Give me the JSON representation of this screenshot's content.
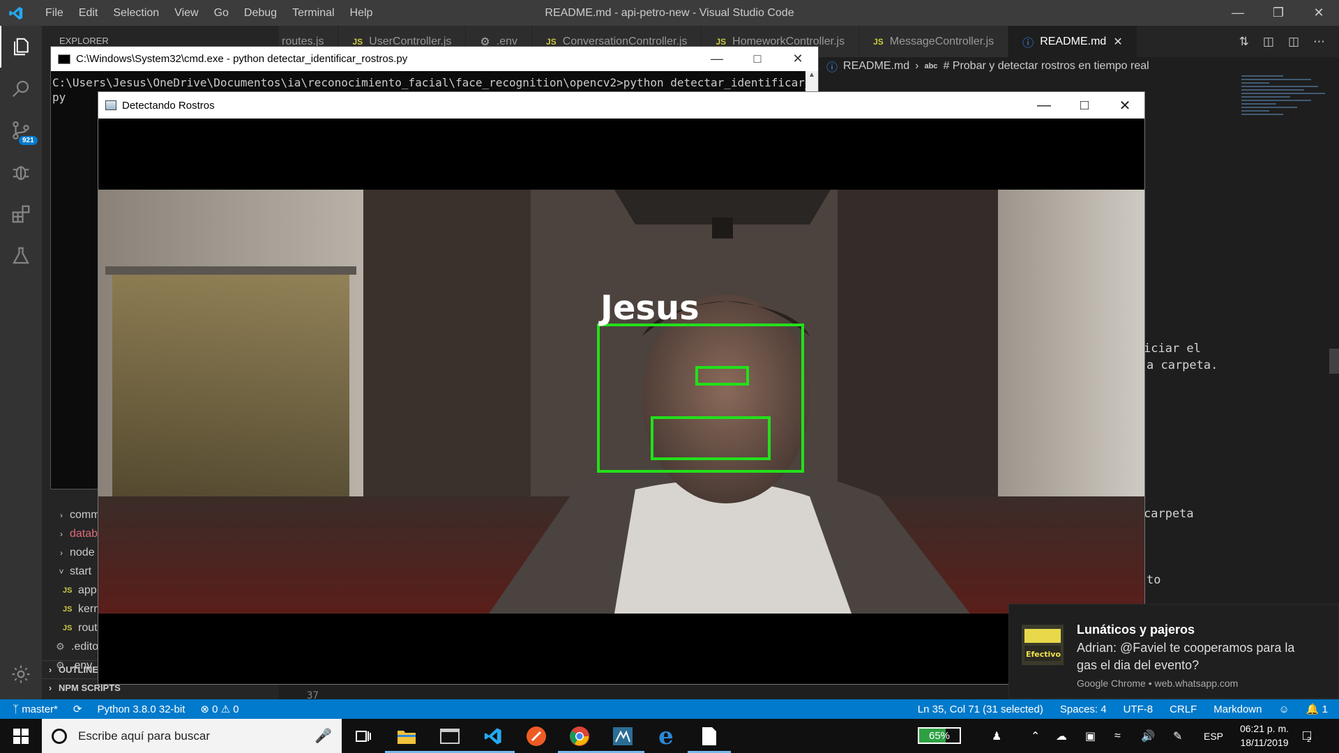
{
  "vscode": {
    "menu": [
      "File",
      "Edit",
      "Selection",
      "View",
      "Go",
      "Debug",
      "Terminal",
      "Help"
    ],
    "window_title": "README.md - api-petro-new - Visual Studio Code",
    "activity_badge": "921",
    "explorer_title": "EXPLORER",
    "tabs": [
      {
        "label": "routes.js",
        "icon": ""
      },
      {
        "label": "UserController.js",
        "icon": "JS"
      },
      {
        "label": ".env",
        "icon": "gear"
      },
      {
        "label": "ConversationController.js",
        "icon": "JS"
      },
      {
        "label": "HomeworkController.js",
        "icon": "JS"
      },
      {
        "label": "MessageController.js",
        "icon": "JS"
      },
      {
        "label": "README.md",
        "icon": "info",
        "active": true
      }
    ],
    "breadcrumb": {
      "file": "README.md",
      "abc_label": "abc",
      "symbol": "# Probar y detectar rostros en tiempo real"
    },
    "editor_lines": [
      {
        "text": "iciar el"
      },
      {
        "text": "a carpeta."
      },
      {
        "text": "carpeta"
      },
      {
        "text": "to"
      }
    ],
    "line_number": "37",
    "tree": [
      {
        "label": "comm",
        "type": "folder",
        "collapsed": true
      },
      {
        "label": "datab",
        "type": "folder",
        "collapsed": true,
        "color": "#e06c75"
      },
      {
        "label": "node",
        "type": "folder",
        "collapsed": true
      },
      {
        "label": "start",
        "type": "folder",
        "collapsed": false
      },
      {
        "label": "app",
        "type": "js"
      },
      {
        "label": "kern",
        "type": "js"
      },
      {
        "label": "rout",
        "type": "js"
      },
      {
        "label": ".edito",
        "type": "gear"
      },
      {
        "label": ".env",
        "type": "gear"
      },
      {
        "label": ".env",
        "type": "plain"
      }
    ],
    "sections": [
      "OUTLINE",
      "NPM SCRIPTS"
    ]
  },
  "statusbar": {
    "branch": "master*",
    "python": "Python 3.8.0 32-bit",
    "errors": "0",
    "warnings": "0",
    "position": "Ln 35, Col 71 (31 selected)",
    "spaces": "Spaces: 4",
    "encoding": "UTF-8",
    "eol": "CRLF",
    "language": "Markdown",
    "bell_count": "1"
  },
  "cmd": {
    "title": "C:\\Windows\\System32\\cmd.exe - python  detectar_identificar_rostros.py",
    "line1": "C:\\Users\\Jesus\\OneDrive\\Documentos\\ia\\reconocimiento_facial\\face_recognition\\opencv2>python detectar_identificar_rostros.",
    "line2": "py"
  },
  "detect_window": {
    "title": "Detectando Rostros",
    "person_label": "Jesus",
    "box_color": "#22e01a"
  },
  "notification": {
    "title": "Lunáticos y pajeros",
    "message": "Adrian: @Faviel  te cooperamos para la gas el dia del evento?",
    "source": "Google Chrome • web.whatsapp.com",
    "thumb_text": "Efectivo"
  },
  "taskbar": {
    "search_placeholder": "Escribe aquí para buscar",
    "battery_percent": "65%",
    "battery_level": 0.65,
    "language": "ESP",
    "time": "06:21 p. m.",
    "date": "18/11/2019",
    "notifications_count": "2"
  }
}
